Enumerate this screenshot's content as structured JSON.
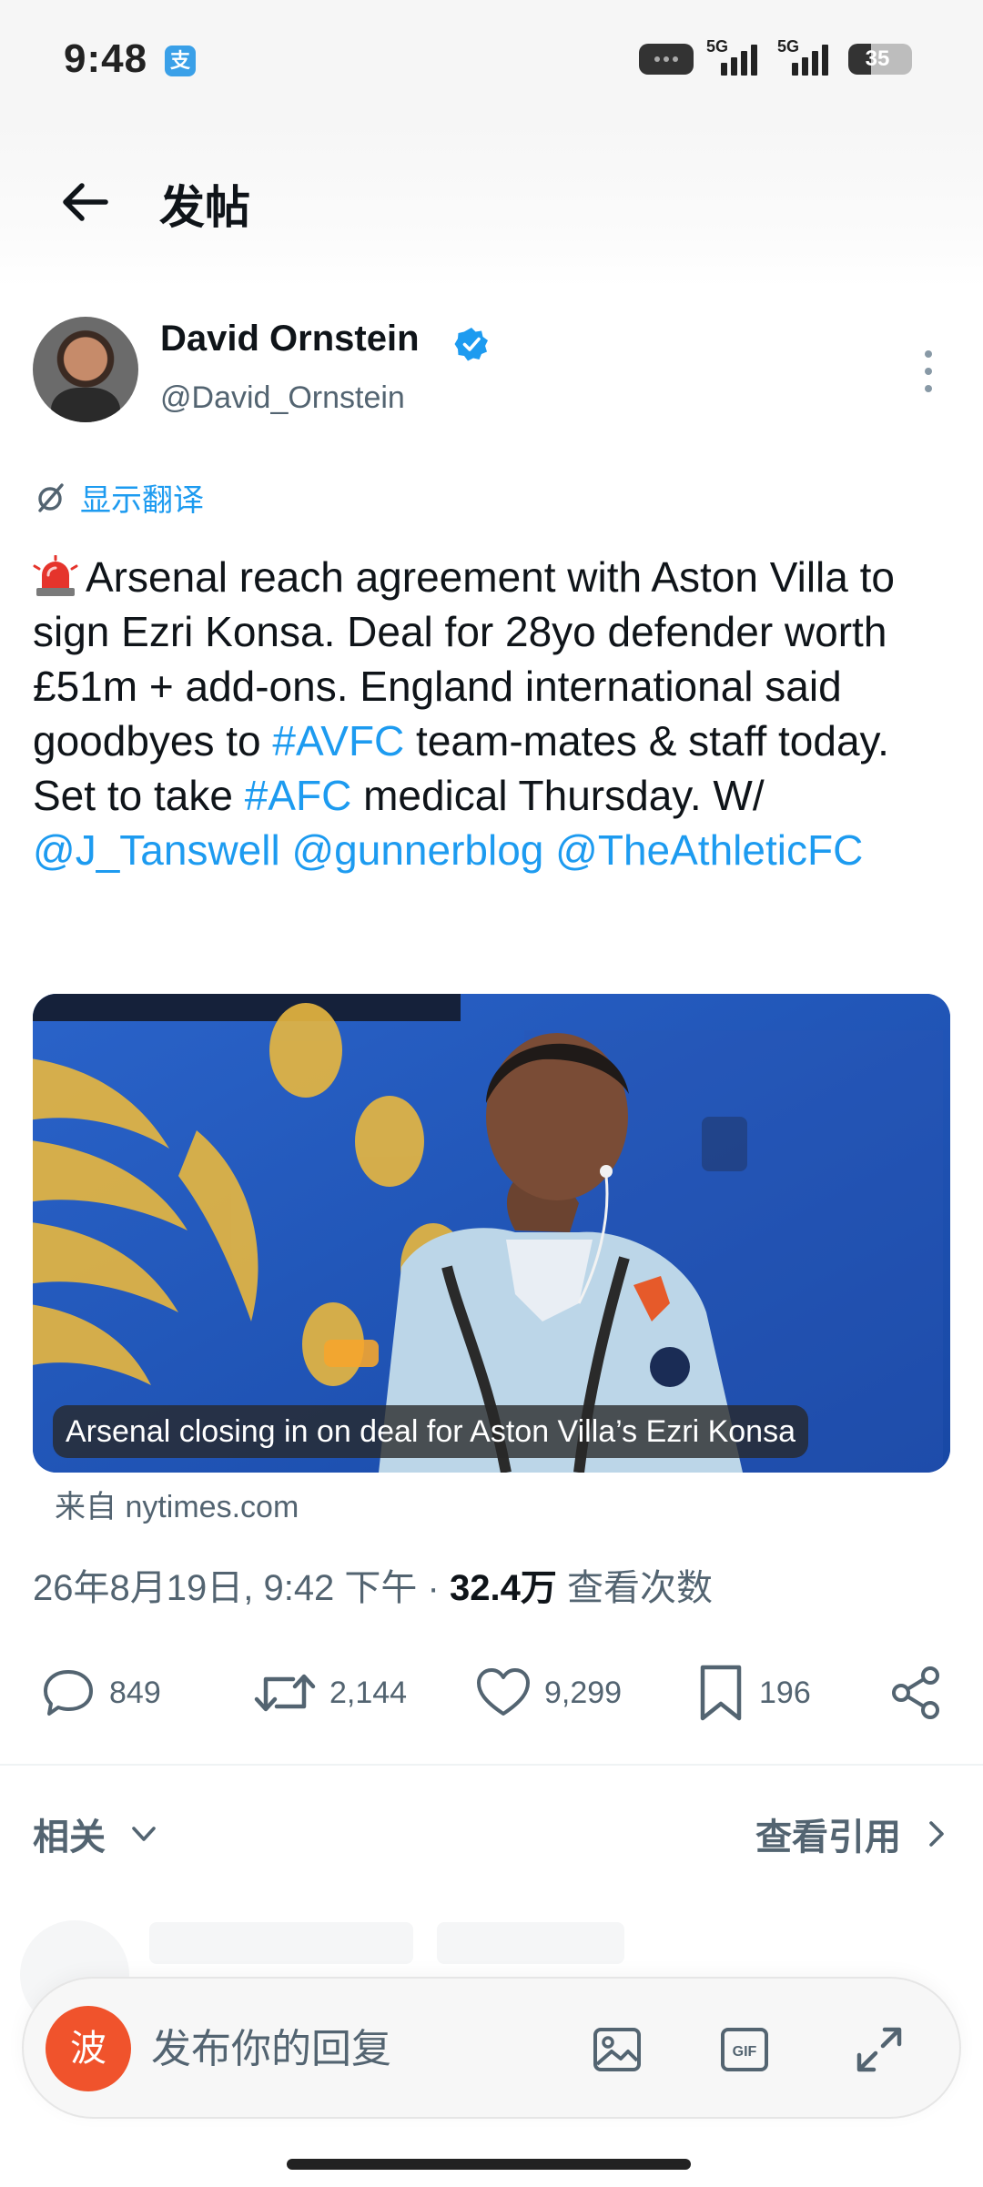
{
  "status_bar": {
    "time": "9:48",
    "app_icon_glyph": "支",
    "network1": "5G",
    "network2": "5G",
    "battery": "35",
    "battery_level": 0.35
  },
  "header": {
    "title": "发帖"
  },
  "author": {
    "name": "David Ornstein",
    "handle": "@David_Ornstein",
    "verified": true
  },
  "translate": {
    "label": "显示翻译"
  },
  "tweet": {
    "text_1": "Arsenal reach agreement with Aston Villa to sign Ezri Konsa. Deal for 28yo defender worth £51m + add-ons. England international said goodbyes to ",
    "hashtag_1": "#AVFC",
    "text_2": " team-mates & staff today. Set to take ",
    "hashtag_2": "#AFC",
    "text_3": " medical Thursday. W/ ",
    "mention_1": "@J_Tanswell",
    "mention_2": "@gunnerblog",
    "mention_3": "@TheAthleticFC"
  },
  "card": {
    "caption": "Arsenal closing in on deal for Aston Villa’s Ezri Konsa",
    "source": "来自 nytimes.com"
  },
  "meta": {
    "datetime": "26年8月19日, 9:42 下午",
    "separator": "·",
    "views": "32.4万",
    "views_label": "查看次数"
  },
  "actions": {
    "replies": "849",
    "reposts": "2,144",
    "likes": "9,299",
    "bookmarks": "196"
  },
  "related": {
    "label": "相关",
    "quotes_label": "查看引用"
  },
  "reply": {
    "avatar_glyph": "波",
    "placeholder": "发布你的回复",
    "gif_label": "GIF"
  },
  "colors": {
    "accent": "#1d9bf0",
    "text_primary": "#0f1419",
    "text_secondary": "#536471",
    "reply_avatar": "#f0532c"
  }
}
